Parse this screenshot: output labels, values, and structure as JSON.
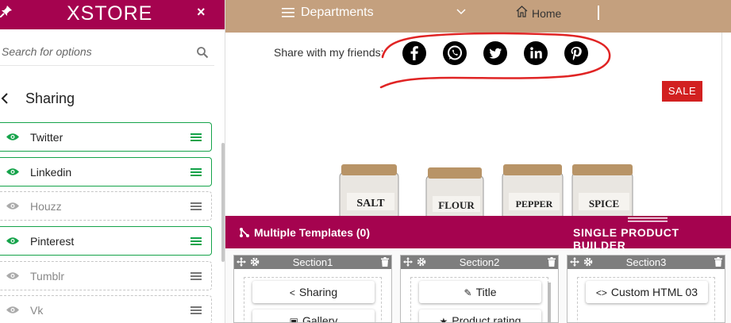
{
  "sidebar": {
    "logo": "XSTORE",
    "close_label": "×",
    "search_placeholder": "Search for options",
    "back_title": "Sharing",
    "options": [
      {
        "label": "Twitter",
        "visible": true
      },
      {
        "label": "Linkedin",
        "visible": true
      },
      {
        "label": "Houzz",
        "visible": false
      },
      {
        "label": "Pinterest",
        "visible": true
      },
      {
        "label": "Tumblr",
        "visible": false
      },
      {
        "label": "Vk",
        "visible": false
      }
    ]
  },
  "header": {
    "departments": "Departments",
    "home": "Home"
  },
  "content": {
    "share_text": "Share with my friends:",
    "social_icons": [
      "facebook-icon",
      "whatsapp-icon",
      "twitter-icon",
      "linkedin-icon",
      "pinterest-icon"
    ],
    "sale_badge": "SALE",
    "jar_labels": [
      "SALT",
      "FLOUR",
      "PEPPER",
      "SPICE"
    ]
  },
  "builder": {
    "multiple_templates": "Multiple Templates (0)",
    "single_product_builder": "SINGLE PRODUCT BUILDER",
    "sections": [
      {
        "title": "Section1",
        "items": [
          "Sharing",
          "Gallery"
        ]
      },
      {
        "title": "Section2",
        "items": [
          "Title",
          "Product rating"
        ]
      },
      {
        "title": "Section3",
        "items": [
          "Custom HTML 03"
        ]
      }
    ]
  },
  "colors": {
    "brand": "#a5034f",
    "header_bg": "#c4a07e",
    "enabled": "#15a34a",
    "sale": "#d22020",
    "annotation": "#e02424"
  }
}
